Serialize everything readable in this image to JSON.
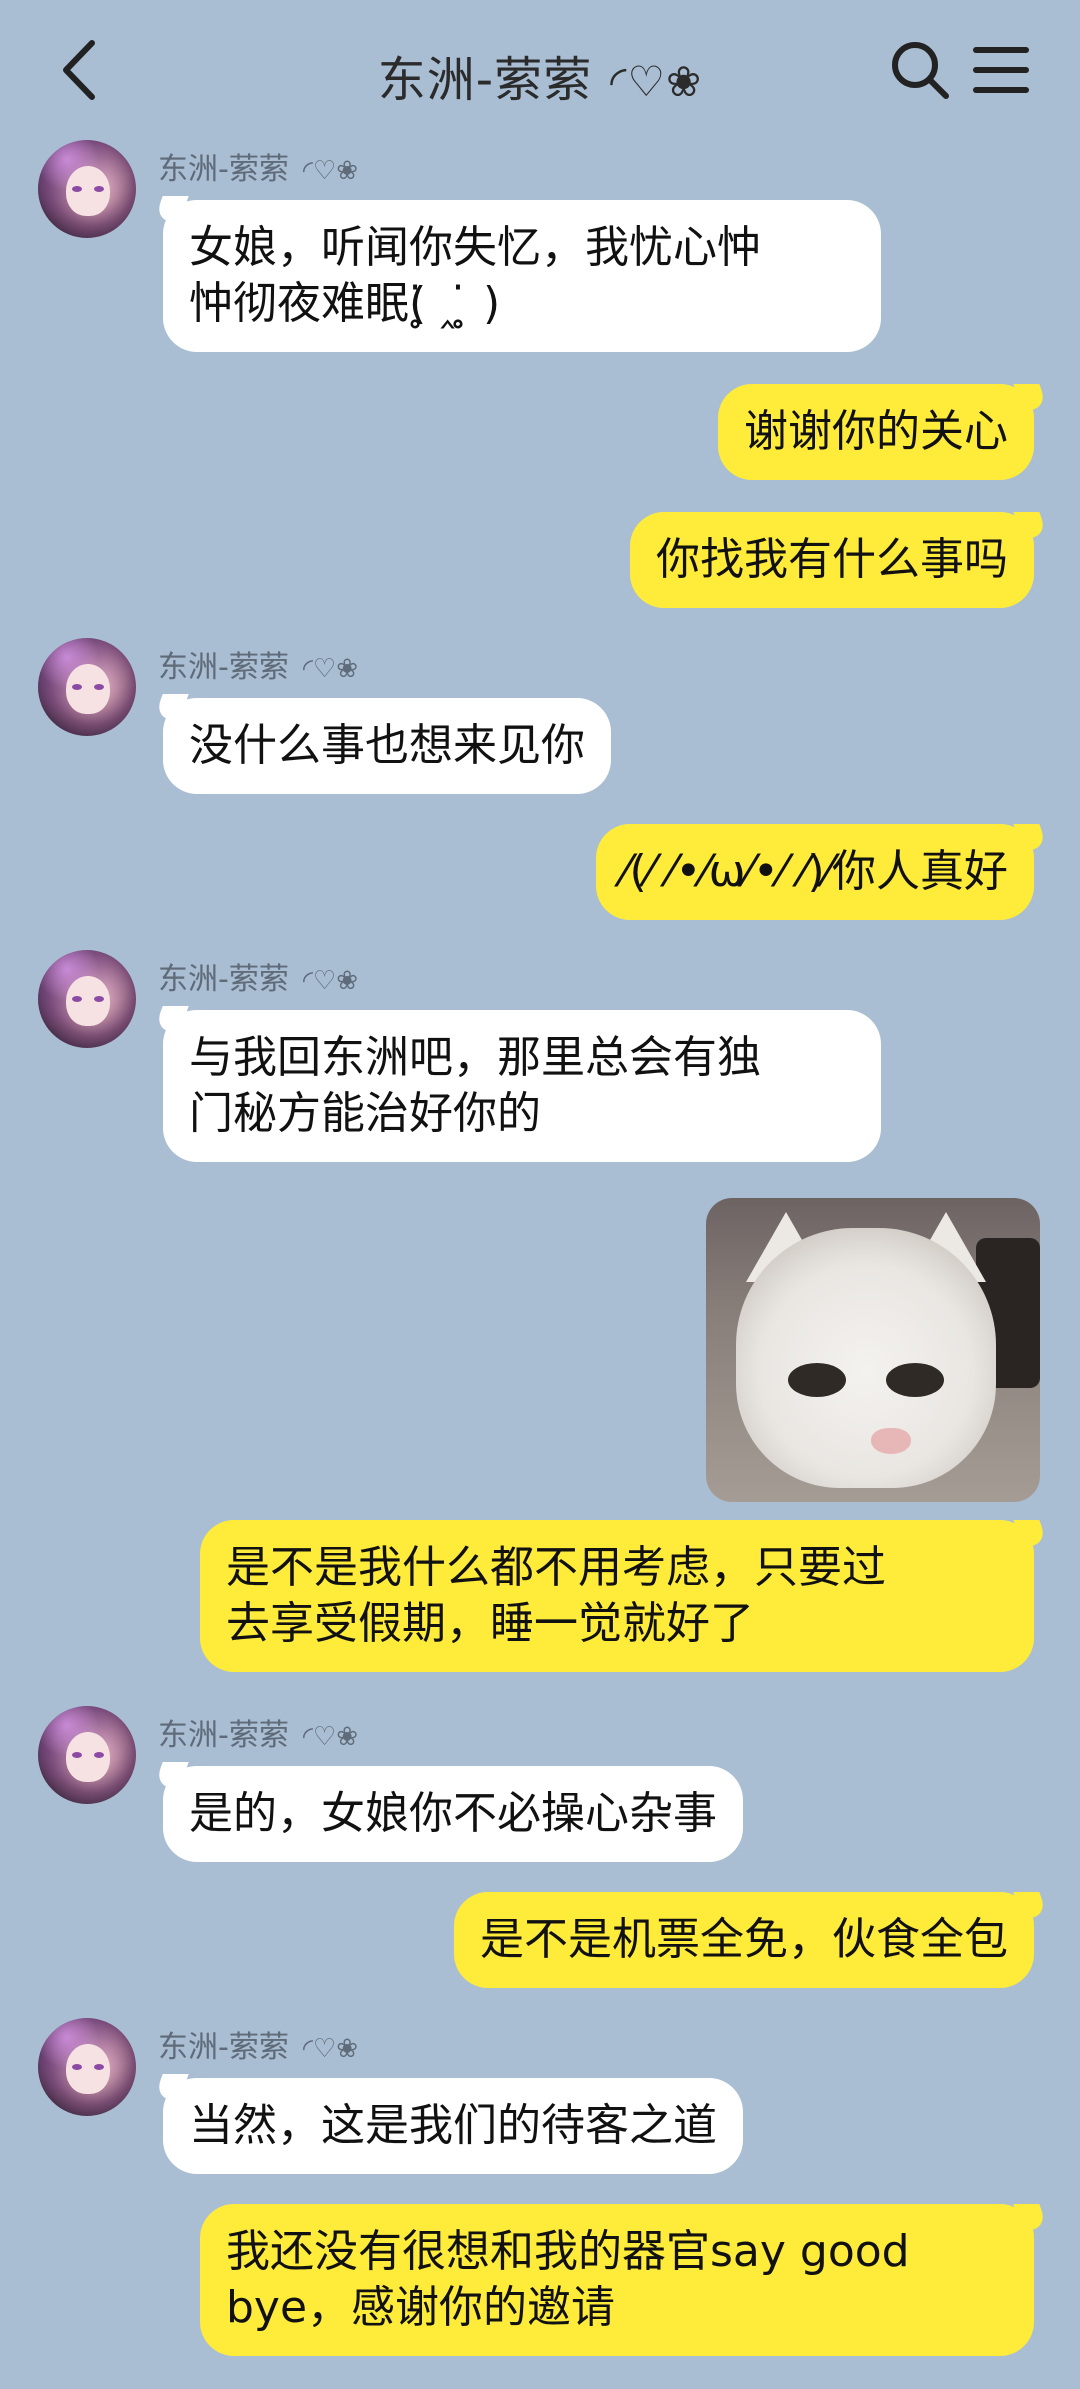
{
  "header": {
    "back_icon": "chevron-left-icon",
    "title": "东洲-萦萦",
    "title_deco": "◜♡❀",
    "search_icon": "search-icon",
    "menu_icon": "menu-icon"
  },
  "contact": {
    "name": "东洲-萦萦",
    "name_deco": "◜♡❀"
  },
  "colors": {
    "background": "#a9bdd3",
    "incoming_bubble": "#ffffff",
    "outgoing_bubble": "#ffec3a"
  },
  "messages": [
    {
      "direction": "in",
      "lines": [
        "女娘，听闻你失忆，我忧心忡",
        "忡彻夜难眠(⁢̥̇ ‸ ⁢̥̇ )"
      ]
    },
    {
      "direction": "out",
      "lines": [
        "谢谢你的关心"
      ]
    },
    {
      "direction": "out",
      "lines": [
        "你找我有什么事吗"
      ]
    },
    {
      "direction": "in",
      "lines": [
        "没什么事也想来见你"
      ]
    },
    {
      "direction": "out",
      "lines": [
        "⁄(⁄ ⁄•⁄ω⁄•⁄ ⁄)⁄你人真好"
      ]
    },
    {
      "direction": "in",
      "lines": [
        "与我回东洲吧，那里总会有独",
        "门秘方能治好你的"
      ]
    },
    {
      "direction": "out",
      "type": "image",
      "image": "cat-meme-image"
    },
    {
      "direction": "out",
      "lines": [
        "是不是我什么都不用考虑，只要过",
        "去享受假期，睡一觉就好了"
      ]
    },
    {
      "direction": "in",
      "lines": [
        "是的，女娘你不必操心杂事"
      ]
    },
    {
      "direction": "out",
      "lines": [
        "是不是机票全免，伙食全包"
      ]
    },
    {
      "direction": "in",
      "lines": [
        "当然，这是我们的待客之道"
      ]
    },
    {
      "direction": "out",
      "lines": [
        "我还没有很想和我的器官say good",
        "bye，感谢你的邀请"
      ]
    }
  ]
}
